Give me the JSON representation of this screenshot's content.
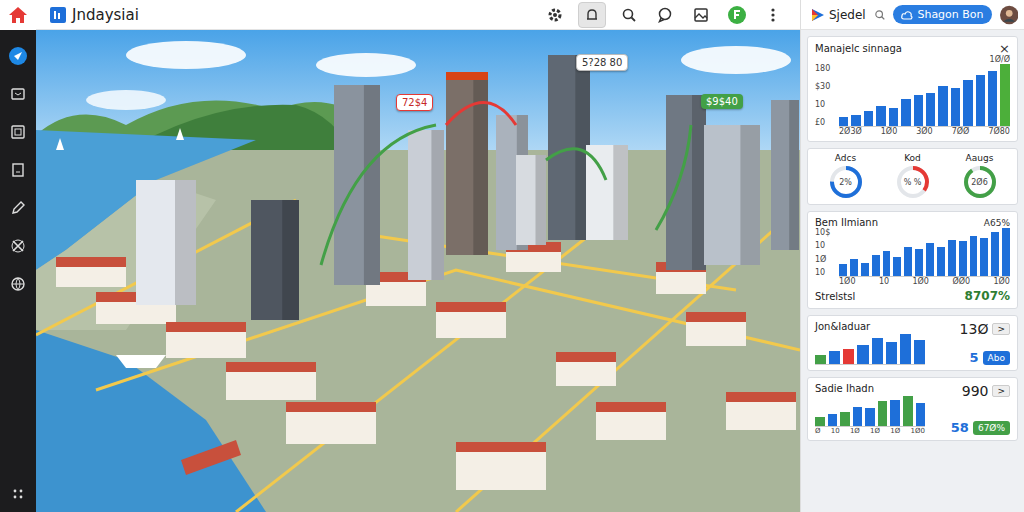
{
  "app": {
    "title": "Jndaysiai"
  },
  "sidebar": {
    "items": [
      {
        "selected": true
      },
      {
        "selected": false
      },
      {
        "selected": false
      },
      {
        "selected": false
      },
      {
        "selected": false
      },
      {
        "selected": false
      },
      {
        "selected": false
      }
    ]
  },
  "toolbar": {
    "items": [
      {
        "selected": false
      },
      {
        "selected": true
      },
      {
        "selected": false
      },
      {
        "selected": false
      },
      {
        "selected": false
      },
      {
        "selected": false
      },
      {
        "selected": false
      }
    ]
  },
  "right_header": {
    "brand": "Sjedel",
    "button": "Shagon Bon"
  },
  "map": {
    "labels": [
      {
        "text": "72$4",
        "kind": "alert"
      },
      {
        "text": "5?28 80",
        "kind": "plain"
      },
      {
        "text": "$9$40",
        "kind": "ok"
      }
    ]
  },
  "manage_card": {
    "title": "Manajelc sinnaga",
    "close": "×",
    "corner": "1Ø/Ø",
    "y_ticks": [
      "180",
      "$30",
      "10",
      "£0"
    ],
    "x_ticks": [
      "2Ø3Ø",
      "1Ø0",
      "3Ø0",
      "7ØØ",
      "7Ø80"
    ],
    "bars": [
      {
        "value": 8,
        "color": "#1e6fd9"
      },
      {
        "value": 10,
        "color": "#1e6fd9"
      },
      {
        "value": 14,
        "color": "#1e6fd9"
      },
      {
        "value": 18,
        "color": "#1e6fd9"
      },
      {
        "value": 16,
        "color": "#1e6fd9"
      },
      {
        "value": 24,
        "color": "#1e6fd9"
      },
      {
        "value": 28,
        "color": "#1e6fd9"
      },
      {
        "value": 30,
        "color": "#1e6fd9"
      },
      {
        "value": 36,
        "color": "#1e6fd9"
      },
      {
        "value": 34,
        "color": "#1e6fd9"
      },
      {
        "value": 42,
        "color": "#1e6fd9"
      },
      {
        "value": 46,
        "color": "#1e6fd9"
      },
      {
        "value": 50,
        "color": "#1e6fd9"
      },
      {
        "value": 56,
        "color": "#4caf3a"
      }
    ]
  },
  "donuts": [
    {
      "label": "Adcs",
      "value": "2%",
      "level": 0.75,
      "color": "#1e6fd9"
    },
    {
      "label": "Kod",
      "value": "% %",
      "level": 0.35,
      "color": "#e53935"
    },
    {
      "label": "Aaugs",
      "value": "2Ø6",
      "level": 0.9,
      "color": "#43a047"
    }
  ],
  "bem_card": {
    "title": "Bem Ilmiann",
    "corner": "A65%",
    "y_ticks": [
      "10$",
      "10",
      "1Ø",
      "10"
    ],
    "x_ticks": [
      "1Ø0",
      "10",
      "1Ø0",
      "ØØ0",
      "1Ø0"
    ],
    "bars": [
      {
        "value": 12,
        "color": "#1e6fd9"
      },
      {
        "value": 18,
        "color": "#1e6fd9"
      },
      {
        "value": 14,
        "color": "#1e6fd9"
      },
      {
        "value": 22,
        "color": "#1e6fd9"
      },
      {
        "value": 26,
        "color": "#1e6fd9"
      },
      {
        "value": 20,
        "color": "#1e6fd9"
      },
      {
        "value": 30,
        "color": "#1e6fd9"
      },
      {
        "value": 28,
        "color": "#1e6fd9"
      },
      {
        "value": 34,
        "color": "#1e6fd9"
      },
      {
        "value": 30,
        "color": "#1e6fd9"
      },
      {
        "value": 38,
        "color": "#1e6fd9"
      },
      {
        "value": 36,
        "color": "#1e6fd9"
      },
      {
        "value": 42,
        "color": "#1e6fd9"
      },
      {
        "value": 40,
        "color": "#1e6fd9"
      },
      {
        "value": 46,
        "color": "#1e6fd9"
      },
      {
        "value": 50,
        "color": "#1e6fd9"
      }
    ],
    "stat": {
      "label": "Strelstsl",
      "value": "8707%"
    }
  },
  "mini_cards": [
    {
      "title": "Jon&Iaduar",
      "value": "13Ø",
      "arrow": ">",
      "foot_value": "5",
      "badge": "Abo",
      "badge_color": "#1e6fd9",
      "x_ticks": [],
      "bars": [
        {
          "value": 10,
          "color": "#43a047"
        },
        {
          "value": 14,
          "color": "#1e6fd9"
        },
        {
          "value": 16,
          "color": "#e53935"
        },
        {
          "value": 20,
          "color": "#1e6fd9"
        },
        {
          "value": 28,
          "color": "#1e6fd9"
        },
        {
          "value": 24,
          "color": "#1e6fd9"
        },
        {
          "value": 32,
          "color": "#1e6fd9"
        },
        {
          "value": 26,
          "color": "#1e6fd9"
        }
      ]
    },
    {
      "title": "Sadie Ihadn",
      "value": "990",
      "arrow": ">",
      "foot_value": "58",
      "badge": "67Ø%",
      "badge_color": "#43a047",
      "x_ticks": [
        "Ø",
        "10",
        "1Ø",
        "1Ø",
        "1Ø",
        "1Ø0"
      ],
      "bars": [
        {
          "value": 10,
          "color": "#43a047"
        },
        {
          "value": 14,
          "color": "#1e6fd9"
        },
        {
          "value": 16,
          "color": "#43a047"
        },
        {
          "value": 22,
          "color": "#1e6fd9"
        },
        {
          "value": 20,
          "color": "#1e6fd9"
        },
        {
          "value": 28,
          "color": "#43a047"
        },
        {
          "value": 30,
          "color": "#1e6fd9"
        },
        {
          "value": 34,
          "color": "#43a047"
        },
        {
          "value": 26,
          "color": "#1e6fd9"
        }
      ]
    }
  ]
}
